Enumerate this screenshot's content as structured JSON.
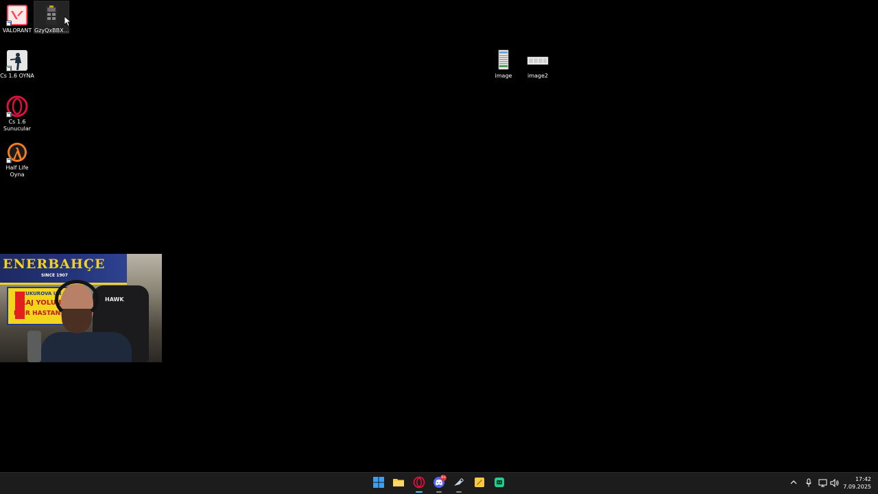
{
  "desktop": {
    "icons": [
      {
        "label": "VALORANT",
        "icon": "valorant-icon",
        "shortcut": true
      },
      {
        "label": "GzyQxBBX...",
        "icon": "image-thumbnail-icon",
        "shortcut": false,
        "selected": true
      },
      {
        "label": "Cs 1.6 OYNA",
        "icon": "counter-strike-icon",
        "shortcut": true
      },
      {
        "label": "Cs 1.6 Sunucular",
        "icon": "opera-gx-icon",
        "shortcut": true
      },
      {
        "label": "Half Life Oyna",
        "icon": "half-life-icon",
        "shortcut": true
      },
      {
        "label": "image",
        "icon": "image-file-icon",
        "shortcut": false
      },
      {
        "label": "image2",
        "icon": "image-file-icon",
        "shortcut": false
      }
    ]
  },
  "webcam": {
    "banner_text": "ENERBAHÇE",
    "banner_sub": "SINCE 1907",
    "sign_line1": "CUKUROVA UN",
    "sign_line2": "ARAJ YOLU F",
    "sign_line3": "EHIR HASTANE",
    "chair_brand": "HAWK"
  },
  "taskbar": {
    "apps": [
      {
        "name": "start-button",
        "icon": "windows-logo-icon"
      },
      {
        "name": "file-explorer-button",
        "icon": "folder-icon"
      },
      {
        "name": "opera-gx-button",
        "icon": "opera-gx-icon",
        "active": true
      },
      {
        "name": "discord-button",
        "icon": "discord-icon",
        "badge": "9+"
      },
      {
        "name": "steam-button",
        "icon": "steam-icon"
      },
      {
        "name": "app-yellow-button",
        "icon": "app-icon"
      },
      {
        "name": "app-green-button",
        "icon": "app-icon"
      }
    ],
    "clock_time": "17:42",
    "clock_date": "7.09.2025",
    "colors": {
      "background": "#1c1c1c",
      "accent": "#4cc2ff"
    }
  }
}
